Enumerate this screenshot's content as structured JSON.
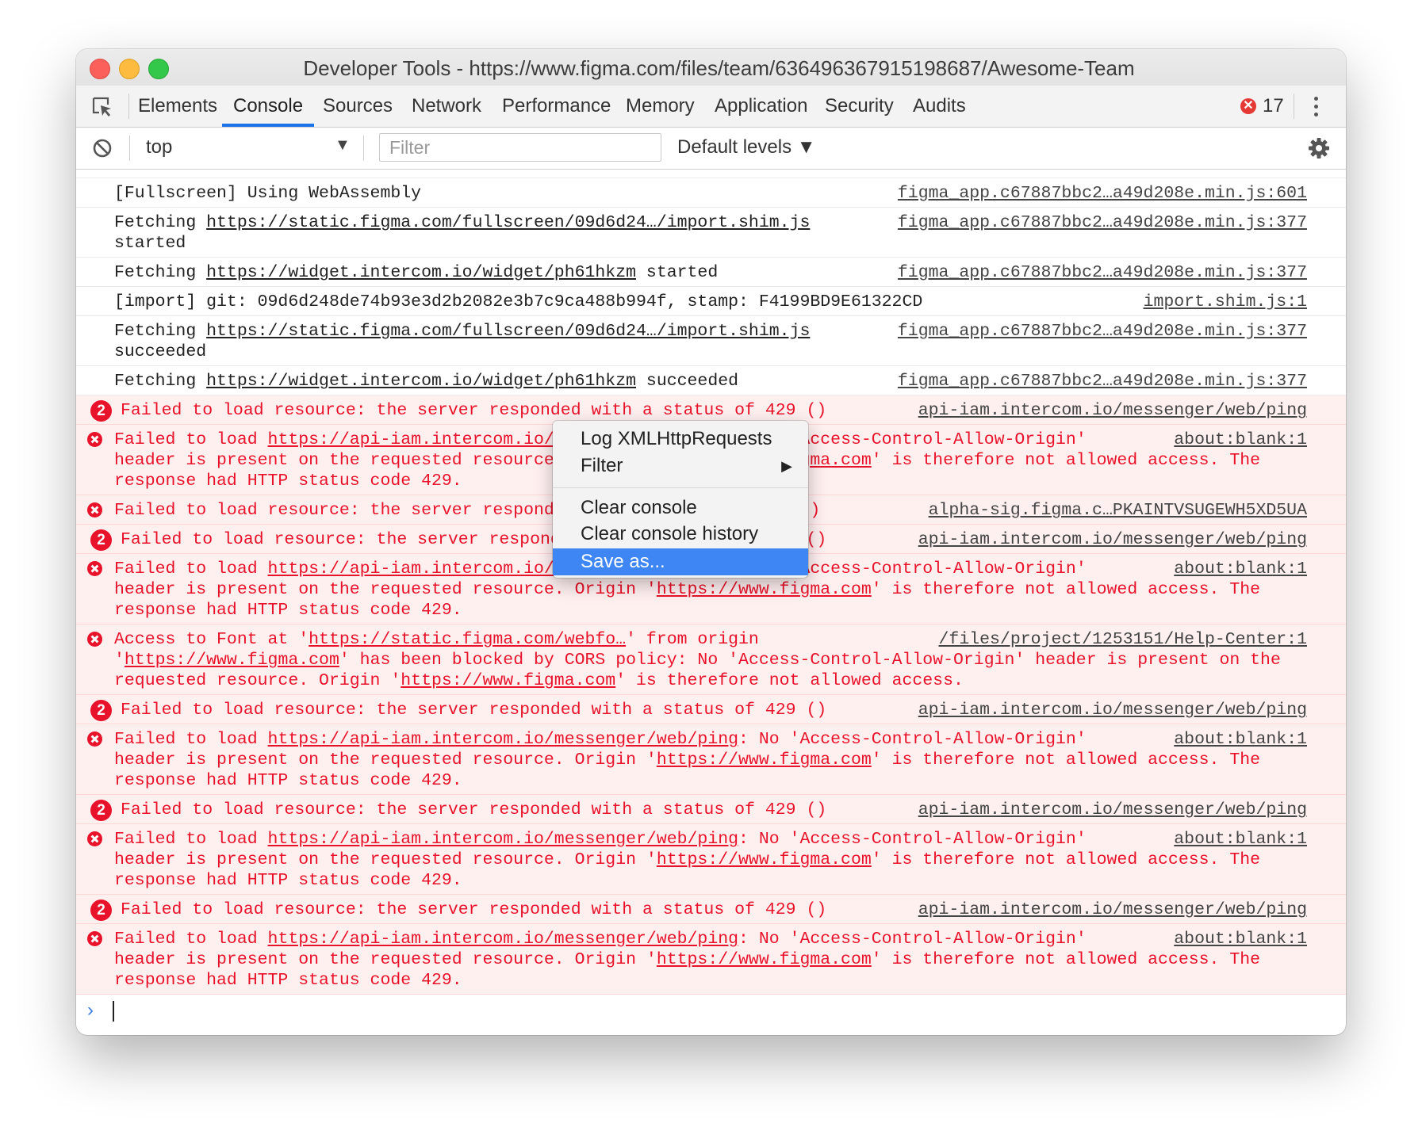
{
  "window": {
    "title": "Developer Tools - https://www.figma.com/files/team/636496367915198687/Awesome-Team"
  },
  "tabs": [
    {
      "label": "Elements"
    },
    {
      "label": "Console"
    },
    {
      "label": "Sources"
    },
    {
      "label": "Network"
    },
    {
      "label": "Performance"
    },
    {
      "label": "Memory"
    },
    {
      "label": "Application"
    },
    {
      "label": "Security"
    },
    {
      "label": "Audits"
    }
  ],
  "active_tab": "Console",
  "error_count": "17",
  "toolbar": {
    "context": "top",
    "filter_placeholder": "Filter",
    "levels": "Default levels ▼"
  },
  "console": {
    "cut_row": {
      "src": "..."
    },
    "rows": [
      {
        "type": "log",
        "src": "figma_app.c67887bbc2…a49d208e.min.js:601",
        "parts": [
          {
            "text": "[Fullscreen] Using WebAssembly"
          }
        ]
      },
      {
        "type": "log",
        "src": "figma_app.c67887bbc2…a49d208e.min.js:377",
        "parts": [
          {
            "text": "Fetching "
          },
          {
            "text": "https://static.figma.com/fullscreen/09d6d24…/import.shim.js",
            "link": true
          },
          {
            "text": "\nstarted"
          }
        ]
      },
      {
        "type": "log",
        "src": "figma_app.c67887bbc2…a49d208e.min.js:377",
        "parts": [
          {
            "text": "Fetching "
          },
          {
            "text": "https://widget.intercom.io/widget/ph61hkzm",
            "link": true
          },
          {
            "text": " started"
          }
        ]
      },
      {
        "type": "log",
        "src": "import.shim.js:1",
        "parts": [
          {
            "text": "[import] git: 09d6d248de74b93e3d2b2082e3b7c9ca488b994f, stamp: F4199BD9E61322CD"
          }
        ]
      },
      {
        "type": "log",
        "src": "figma_app.c67887bbc2…a49d208e.min.js:377",
        "parts": [
          {
            "text": "Fetching "
          },
          {
            "text": "https://static.figma.com/fullscreen/09d6d24…/import.shim.js",
            "link": true
          },
          {
            "text": "\nsucceeded"
          }
        ]
      },
      {
        "type": "log",
        "src": "figma_app.c67887bbc2…a49d208e.min.js:377",
        "parts": [
          {
            "text": "Fetching "
          },
          {
            "text": "https://widget.intercom.io/widget/ph61hkzm",
            "link": true
          },
          {
            "text": " succeeded"
          }
        ]
      },
      {
        "type": "repeat",
        "count": "2",
        "src": "api-iam.intercom.io/messenger/web/ping",
        "parts": [
          {
            "text": "Failed to load resource: the server responded with a status of 429 ()"
          }
        ]
      },
      {
        "type": "error",
        "src": "about:blank:1",
        "parts": [
          {
            "text": "Failed to load "
          },
          {
            "text": "https://api-iam.intercom.io/messenger/web/ping",
            "link": true
          },
          {
            "text": ": No 'Access-Control-Allow-Origin' header is present on the requested resource. Origin '"
          },
          {
            "text": "https://www.figma.com",
            "link": true
          },
          {
            "text": "' is therefore not allowed access. The response had HTTP status code 429."
          }
        ]
      },
      {
        "type": "error",
        "src": "alpha-sig.figma.c…PKAINTVSUGEWH5XD5UA",
        "parts": [
          {
            "text": "Failed to load resource: the server responded with a status of 429 ()"
          }
        ]
      },
      {
        "type": "repeat",
        "count": "2",
        "src": "api-iam.intercom.io/messenger/web/ping",
        "parts": [
          {
            "text": "Failed to load resource: the server responded with a status of 429 ()"
          }
        ]
      },
      {
        "type": "error",
        "src": "about:blank:1",
        "parts": [
          {
            "text": "Failed to load "
          },
          {
            "text": "https://api-iam.intercom.io/messenger/web/ping",
            "link": true
          },
          {
            "text": ": No 'Access-Control-Allow-Origin' header is present on the requested resource. Origin '"
          },
          {
            "text": "https://www.figma.com",
            "link": true
          },
          {
            "text": "' is therefore not allowed access. The response had HTTP status code 429."
          }
        ]
      },
      {
        "type": "error",
        "src": "/files/project/1253151/Help-Center:1",
        "parts": [
          {
            "text": "Access to Font at '"
          },
          {
            "text": "https://static.figma.com/webfo…",
            "link": true
          },
          {
            "text": "' from origin '"
          },
          {
            "text": "https://www.figma.com",
            "link": true
          },
          {
            "text": "' has been blocked by CORS policy: No 'Access-Control-Allow-Origin' header is present on the requested resource. Origin '"
          },
          {
            "text": "https://www.figma.com",
            "link": true
          },
          {
            "text": "' is therefore not allowed access."
          }
        ]
      },
      {
        "type": "repeat",
        "count": "2",
        "src": "api-iam.intercom.io/messenger/web/ping",
        "parts": [
          {
            "text": "Failed to load resource: the server responded with a status of 429 ()"
          }
        ]
      },
      {
        "type": "error",
        "src": "about:blank:1",
        "parts": [
          {
            "text": "Failed to load "
          },
          {
            "text": "https://api-iam.intercom.io/messenger/web/ping",
            "link": true
          },
          {
            "text": ": No 'Access-Control-Allow-Origin' header is present on the requested resource. Origin '"
          },
          {
            "text": "https://www.figma.com",
            "link": true
          },
          {
            "text": "' is therefore not allowed access. The response had HTTP status code 429."
          }
        ]
      },
      {
        "type": "repeat",
        "count": "2",
        "src": "api-iam.intercom.io/messenger/web/ping",
        "parts": [
          {
            "text": "Failed to load resource: the server responded with a status of 429 ()"
          }
        ]
      },
      {
        "type": "error",
        "src": "about:blank:1",
        "parts": [
          {
            "text": "Failed to load "
          },
          {
            "text": "https://api-iam.intercom.io/messenger/web/ping",
            "link": true
          },
          {
            "text": ": No 'Access-Control-Allow-Origin' header is present on the requested resource. Origin '"
          },
          {
            "text": "https://www.figma.com",
            "link": true
          },
          {
            "text": "' is therefore not allowed access. The response had HTTP status code 429."
          }
        ]
      },
      {
        "type": "repeat",
        "count": "2",
        "src": "api-iam.intercom.io/messenger/web/ping",
        "parts": [
          {
            "text": "Failed to load resource: the server responded with a status of 429 ()"
          }
        ]
      },
      {
        "type": "error",
        "src": "about:blank:1",
        "parts": [
          {
            "text": "Failed to load "
          },
          {
            "text": "https://api-iam.intercom.io/messenger/web/ping",
            "link": true
          },
          {
            "text": ": No 'Access-Control-Allow-Origin' header is present on the requested resource. Origin '"
          },
          {
            "text": "https://www.figma.com",
            "link": true
          },
          {
            "text": "' is therefore not allowed access. The response had HTTP status code 429."
          }
        ]
      }
    ]
  },
  "context_menu": {
    "items": [
      {
        "label": "Log XMLHttpRequests",
        "highlighted": false
      },
      {
        "label": "Filter",
        "highlighted": false,
        "submenu": true
      },
      {
        "label": "Clear console",
        "highlighted": false
      },
      {
        "label": "Clear console history",
        "highlighted": false
      },
      {
        "label": "Save as...",
        "highlighted": true
      }
    ]
  },
  "colors": {
    "error_text": "#e8132b",
    "error_bg": "#fff0f0",
    "active_tab_underline": "#1a73e8",
    "menu_highlight": "#3f86f5"
  }
}
